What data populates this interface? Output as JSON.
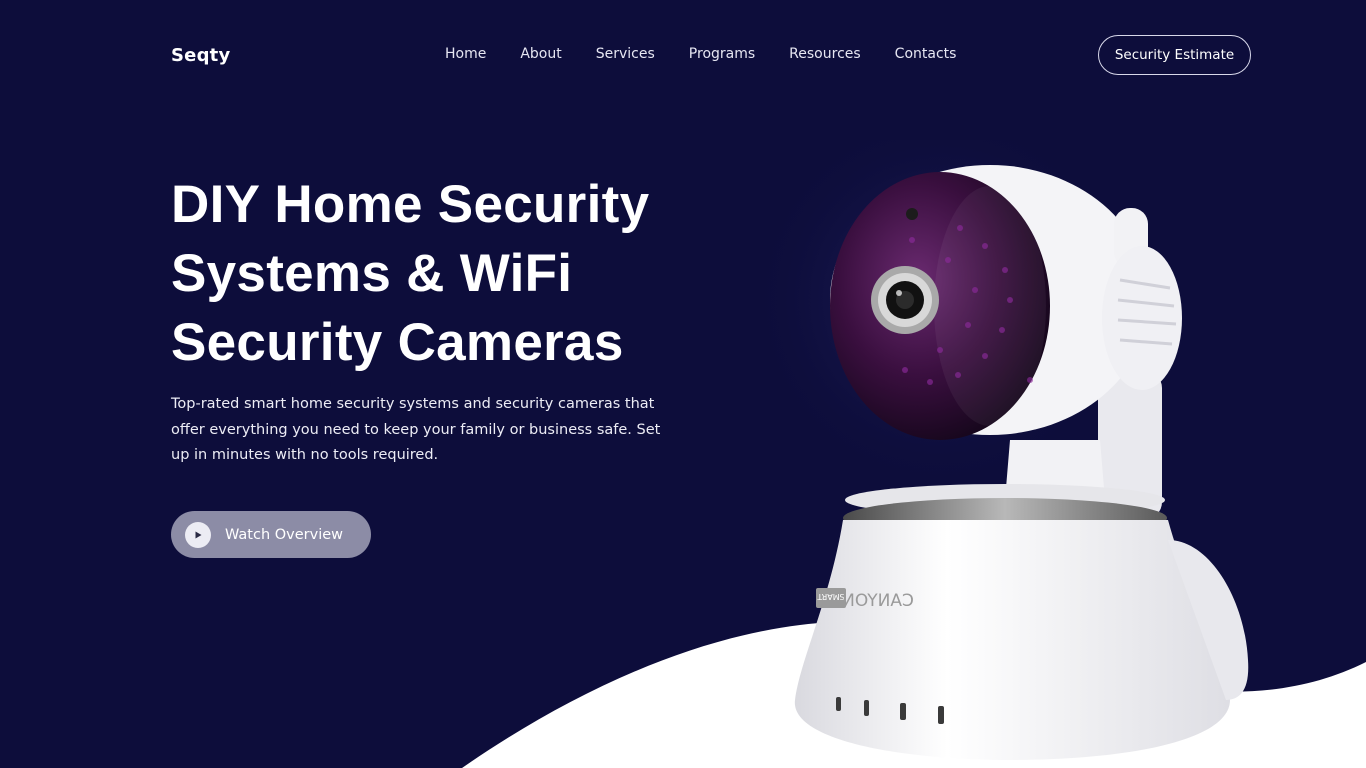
{
  "header": {
    "logo": "Seqty",
    "nav": [
      "Home",
      "About",
      "Services",
      "Programs",
      "Resources",
      "Contacts"
    ],
    "cta_label": "Security Estimate"
  },
  "hero": {
    "title_lines": [
      "DIY Home Security",
      "Systems & WiFi",
      "Security Cameras"
    ],
    "description": "Top-rated smart home security systems and security cameras that offer everything you need to keep your family or business safe. Set up in minutes with no tools required.",
    "watch_label": "Watch Overview"
  },
  "product": {
    "brand_text": "CANYON",
    "badge_text": "SMART"
  },
  "colors": {
    "background": "#0d0d3b",
    "wave": "#ffffff",
    "button_fill": "#8c8ca6",
    "lens_purple": "#3a0f3f"
  },
  "icons": {
    "play": "play-icon"
  }
}
